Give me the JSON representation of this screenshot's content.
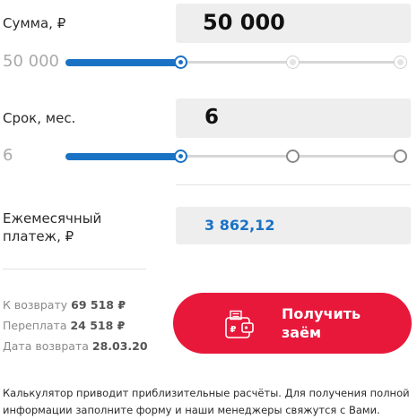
{
  "amount": {
    "label": "Сумма, ₽",
    "value": "50 000",
    "min_label": "50 000",
    "slider_position": 0.0
  },
  "term": {
    "label": "Срок, мес.",
    "value": "6",
    "min_label": "6",
    "slider_position": 0.0
  },
  "payment": {
    "label_line1": "Ежемесячный",
    "label_line2": "платеж, ₽",
    "value": "3 862,12"
  },
  "summary": {
    "return_label": "К возврату",
    "return_value": "69 518 ₽",
    "overpay_label": "Переплата",
    "overpay_value": "24 518 ₽",
    "date_label": "Дата возврата",
    "date_value": "28.03.20"
  },
  "cta": {
    "line1": "Получить",
    "line2": "заём",
    "icon": "wallet-icon"
  },
  "note": {
    "line1": "Калькулятор приводит приблизительные расчёты. Для получения полной",
    "line2": "информации заполните форму и наши менеджеры свяжутся с Вами."
  },
  "colors": {
    "accent": "#1a72c5",
    "cta": "#e8183b",
    "field_bg": "#eeeeee",
    "muted": "#a9a9a9"
  }
}
